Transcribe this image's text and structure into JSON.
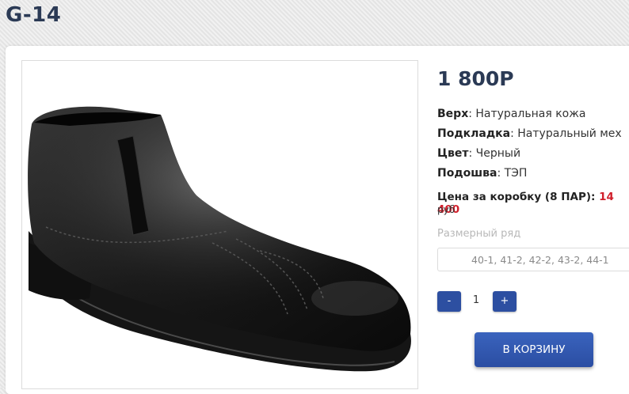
{
  "product": {
    "title": "G-14",
    "price": "1 800Р",
    "specs": [
      {
        "label": "Верх",
        "value": ": Натуральная кожа"
      },
      {
        "label": "Подкладка",
        "value": ": Натуральный мех"
      },
      {
        "label": "Цвет",
        "value": ": Черный"
      },
      {
        "label": "Подошва",
        "value": ": ТЭП"
      }
    ],
    "box_price_label": "Цена за коробку (8 ПАР):",
    "box_price_value": "14 400",
    "box_price_unit": "руб",
    "size_label": "Размерный ряд",
    "size_value": "40-1, 41-2, 42-2, 43-2, 44-1"
  },
  "quantity": {
    "minus": "-",
    "value": "1",
    "plus": "+"
  },
  "cart": {
    "label": "В КОРЗИНУ"
  },
  "colors": {
    "accent": "#2d4fa1",
    "price_red": "#d01f2b",
    "title": "#2b3a55"
  }
}
